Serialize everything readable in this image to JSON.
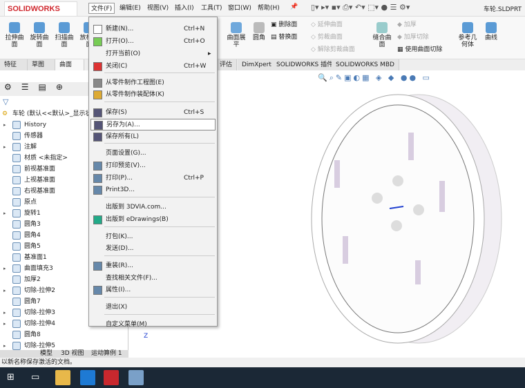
{
  "app": {
    "logo": "SOLIDWORKS",
    "doc_title": "车轮.SLDPRT"
  },
  "menubar": [
    "文件(F)",
    "编辑(E)",
    "视图(V)",
    "插入(I)",
    "工具(T)",
    "窗口(W)",
    "帮助(H)"
  ],
  "ribbon": {
    "left": [
      "拉伸曲面",
      "旋转曲面",
      "扫描曲面",
      "放样曲面"
    ],
    "mid": [
      "曲面展平",
      "圆角"
    ],
    "small1": [
      "删除面",
      "替换面"
    ],
    "small2": [
      "延伸曲面",
      "剪裁曲面",
      "解除剪裁曲面"
    ],
    "knit": "缝合曲面",
    "small3": [
      "加厚",
      "加厚切除",
      "使用曲面切除"
    ],
    "right": [
      "参考几何体",
      "曲线"
    ]
  },
  "tabs": [
    "特征",
    "草图",
    "曲面",
    "评估",
    "DimXpert",
    "SOLIDWORKS 插件",
    "SOLIDWORKS MBD"
  ],
  "tree": {
    "root": "车轮 (默认<<默认>_显示状",
    "items": [
      "History",
      "传感器",
      "注解",
      "材质 <未指定>",
      "前视基准面",
      "上视基准面",
      "右视基准面",
      "原点",
      "旋转1",
      "圆角3",
      "圆角4",
      "圆角5",
      "基准面1",
      "曲面填充3",
      "加厚2",
      "切除-拉伸2",
      "圆角7",
      "切除-拉伸3",
      "切除-拉伸4",
      "圆角8",
      "切除-拉伸5"
    ]
  },
  "bottom_tabs": [
    "模型",
    "3D 视图",
    "运动算例 1"
  ],
  "file_menu": [
    {
      "label": "新建(N)...",
      "shortcut": "Ctrl+N"
    },
    {
      "label": "打开(O)...",
      "shortcut": "Ctrl+O"
    },
    {
      "label": "打开当前(O)",
      "shortcut": "▸"
    },
    {
      "label": "关闭(C)",
      "shortcut": "Ctrl+W"
    },
    {
      "label": "从零件制作工程图(E)",
      "shortcut": ""
    },
    {
      "label": "从零件制作装配体(K)",
      "shortcut": ""
    },
    {
      "label": "保存(S)",
      "shortcut": "Ctrl+S"
    },
    {
      "label": "另存为(A)...",
      "shortcut": ""
    },
    {
      "label": "保存所有(L)",
      "shortcut": ""
    },
    {
      "label": "页面设置(G)...",
      "shortcut": ""
    },
    {
      "label": "打印预览(V)...",
      "shortcut": ""
    },
    {
      "label": "打印(P)...",
      "shortcut": "Ctrl+P"
    },
    {
      "label": "Print3D...",
      "shortcut": ""
    },
    {
      "label": "出版到 3DVIA.com...",
      "shortcut": ""
    },
    {
      "label": "出版到 eDrawings(B)",
      "shortcut": ""
    },
    {
      "label": "打包(K)...",
      "shortcut": ""
    },
    {
      "label": "发送(D)...",
      "shortcut": ""
    },
    {
      "label": "重装(R)...",
      "shortcut": ""
    },
    {
      "label": "查找相关文件(F)...",
      "shortcut": ""
    },
    {
      "label": "属性(I)...",
      "shortcut": ""
    },
    {
      "label": "退出(X)",
      "shortcut": ""
    },
    {
      "label": "自定义菜单(M)",
      "shortcut": ""
    }
  ],
  "status": "以新名称保存激活的文档。"
}
